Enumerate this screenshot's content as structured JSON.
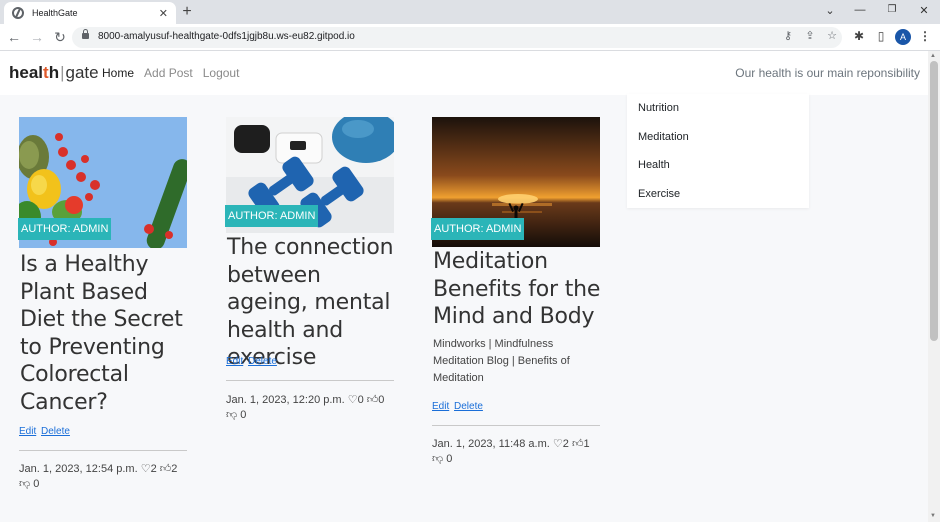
{
  "browser": {
    "tab_title": "HealthGate",
    "url": "8000-amalyusuf-healthgate-0dfs1jgjb8u.ws-eu82.gitpod.io",
    "profile_initial": "A"
  },
  "site": {
    "brand_a": "heal",
    "brand_accent": "t",
    "brand_b": "h",
    "brand_sep": "|",
    "brand_c": "gate",
    "nav": [
      "Home",
      "Add Post",
      "Logout"
    ],
    "motto": "Our health is our main reponsibility"
  },
  "categories": [
    "Nutrition",
    "Meditation",
    "Health",
    "Exercise"
  ],
  "posts": [
    {
      "author": "AUTHOR: ADMIN",
      "title": "Is a Healthy Plant Based Diet the Secret to Preventing Colorectal Cancer?",
      "excerpt": "",
      "edit": "Edit",
      "delete": "Delete",
      "date": "Jan. 1, 2023, 12:54 p.m.",
      "likes": "2",
      "thumbs_up": "2",
      "thumbs_down": "0"
    },
    {
      "author": "AUTHOR: ADMIN",
      "title": "The connection between ageing, mental health and exercise",
      "excerpt": "",
      "edit": "Edit",
      "delete": "Delete",
      "date": "Jan. 1, 2023, 12:20 p.m.",
      "likes": "0",
      "thumbs_up": "0",
      "thumbs_down": "0"
    },
    {
      "author": "AUTHOR: ADMIN",
      "title": "Meditation Benefits for the Mind and Body",
      "excerpt": "Mindworks | Mindfulness Meditation Blog | Benefits of Meditation",
      "edit": "Edit",
      "delete": "Delete",
      "date": "Jan. 1, 2023, 11:48 a.m.",
      "likes": "2",
      "thumbs_up": "1",
      "thumbs_down": "0"
    }
  ],
  "colors": {
    "author_badge": "#2bb5b8",
    "brand_accent": "#e05a2b",
    "link": "#1a6ed8"
  },
  "icons": {
    "heart": "heart-icon",
    "thumbs_up": "thumbs-up-icon",
    "thumbs_down": "thumbs-down-icon"
  }
}
